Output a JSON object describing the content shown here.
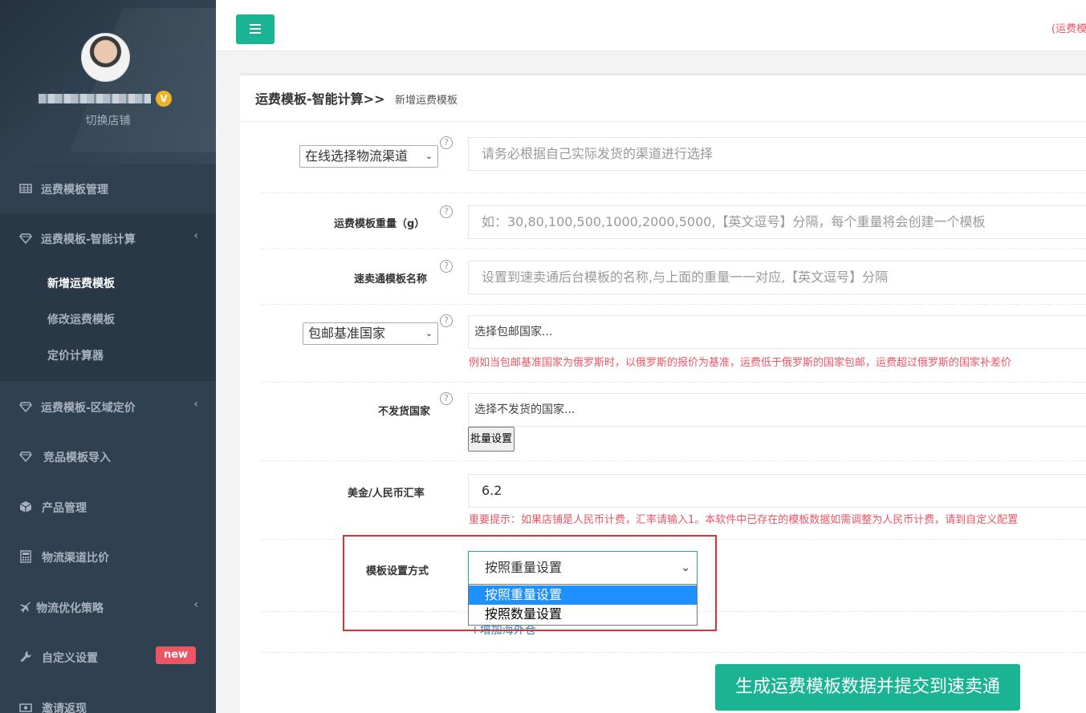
{
  "sidebar": {
    "switch_shop": "切换店铺",
    "items": [
      {
        "label": "运费模板管理",
        "icon": "table-icon"
      },
      {
        "label": "运费模板-智能计算",
        "icon": "diamond-icon",
        "arrow": "‹"
      },
      {
        "label": "运费模板-区域定价",
        "icon": "diamond-icon",
        "arrow": "‹"
      },
      {
        "label": "竞品模板导入",
        "icon": "diamond-icon"
      },
      {
        "label": "产品管理",
        "icon": "cube-icon"
      },
      {
        "label": "物流渠道比价",
        "icon": "calculator-icon"
      },
      {
        "label": "物流优化策略",
        "icon": "plane-icon",
        "arrow": "‹"
      },
      {
        "label": "自定义设置",
        "icon": "wrench-icon",
        "badge": "new"
      },
      {
        "label": "邀请返现",
        "icon": "money-icon"
      }
    ],
    "subitems": [
      "新增运费模板",
      "修改运费模板",
      "定价计算器"
    ]
  },
  "topbar": {
    "right_text": "(运费模"
  },
  "page": {
    "title_main": "运费模板-智能计算",
    "title_sep": ">>",
    "title_sub": "新增运费模板"
  },
  "form": {
    "channel_select": "在线选择物流渠道",
    "channel_placeholder": "请务必根据自己实际发货的渠道进行选择",
    "weight_label": "运费模板重量（g）",
    "weight_placeholder": "如：30,80,100,500,1000,2000,5000,【英文逗号】分隔，每个重量将会创建一个模板",
    "name_label": "速卖通模板名称",
    "name_placeholder": "设置到速卖通后台模板的名称,与上面的重量一一对应,【英文逗号】分隔",
    "base_country_select": "包邮基准国家",
    "base_country_placeholder": "选择包邮国家...",
    "base_country_tip": "例如当包邮基准国家为俄罗斯时，以俄罗斯的报价为基准，运费低于俄罗斯的国家包邮，运费超过俄罗斯的国家补差价",
    "no_ship_label": "不发货国家",
    "no_ship_placeholder": "选择不发货的国家...",
    "batch_button": "批量设置",
    "rate_label": "美金/人民币汇率",
    "rate_value": "6.2",
    "rate_tip": "重要提示：如果店铺是人民币计费，汇率请输入1。本软件中已存在的模板数据如需调整为人民币计费，请到自定义配置",
    "mode_label": "模板设置方式",
    "mode_value": "按照重量设置",
    "mode_options": [
      "按照重量设置",
      "按照数量设置"
    ],
    "add_warehouse": "+增加海外仓",
    "submit": "生成运费模板数据并提交到速卖通"
  },
  "colors": {
    "accent": "#1ab394",
    "danger": "#ed5565",
    "sidebar": "#2f4050",
    "highlight": "#e0312e"
  }
}
